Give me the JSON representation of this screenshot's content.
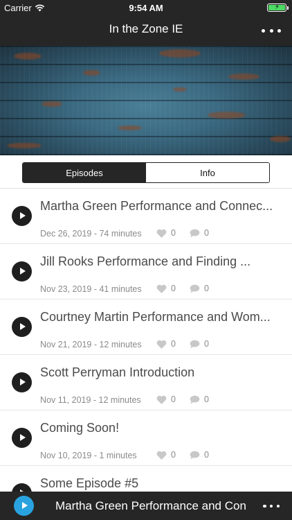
{
  "status_bar": {
    "carrier": "Carrier",
    "time": "9:54 AM",
    "battery_color": "#4cd964"
  },
  "nav": {
    "title": "In the Zone IE",
    "more_icon": "more-horizontal-icon"
  },
  "tabs": [
    {
      "label": "Episodes",
      "active": true
    },
    {
      "label": "Info",
      "active": false
    }
  ],
  "episodes": [
    {
      "title": "Martha Green Performance and Connec...",
      "meta": "Dec 26, 2019 - 74 minutes",
      "likes": "0",
      "comments": "0"
    },
    {
      "title": "Jill Rooks Performance and Finding ...",
      "meta": "Nov 23, 2019 - 41 minutes",
      "likes": "0",
      "comments": "0"
    },
    {
      "title": "Courtney Martin Performance and Wom...",
      "meta": "Nov 21, 2019 - 12 minutes",
      "likes": "0",
      "comments": "0"
    },
    {
      "title": "Scott Perryman Introduction",
      "meta": "Nov 11, 2019 - 12 minutes",
      "likes": "0",
      "comments": "0"
    },
    {
      "title": "Coming Soon!",
      "meta": "Nov 10, 2019 - 1 minutes",
      "likes": "0",
      "comments": "0"
    },
    {
      "title": "Some Episode #5",
      "meta": "",
      "likes": "",
      "comments": ""
    }
  ],
  "player": {
    "title": "Martha Green Performance and Con",
    "accent": "#29a3e0"
  }
}
